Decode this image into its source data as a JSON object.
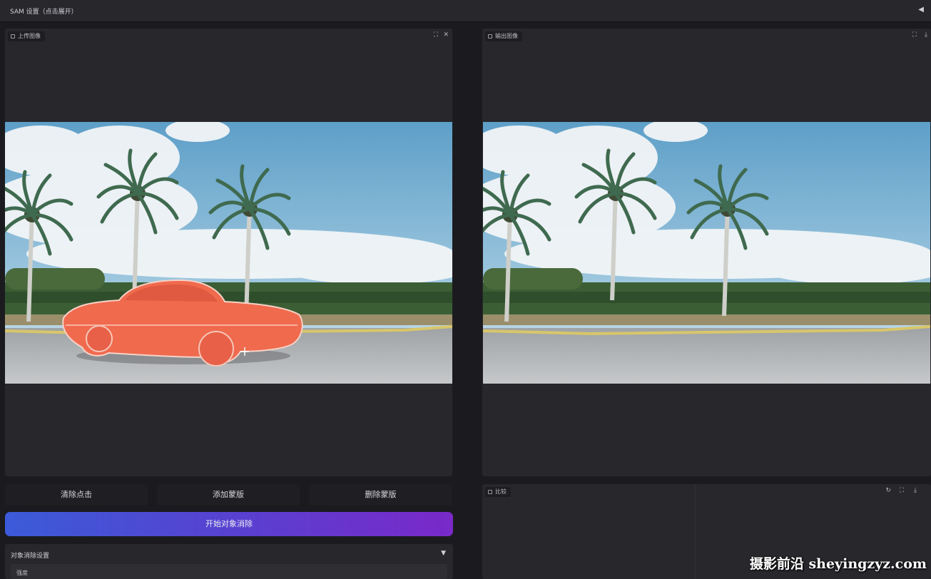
{
  "app": {
    "sam_settings_title": "SAM 设置（点击展开）",
    "collapse_glyph": "◀"
  },
  "upload_panel": {
    "label": "上传图像",
    "fullscreen_glyph": "⛶",
    "close_glyph": "✕"
  },
  "output_panel": {
    "label": "输出图像",
    "fullscreen_glyph": "⛶",
    "download_glyph": "⤓"
  },
  "compare_panel": {
    "label": "比较",
    "reset_glyph": "↻",
    "fullscreen_glyph": "⛶",
    "download_glyph": "⤓"
  },
  "actions": {
    "clear_clicks": "清除点击",
    "add_mask": "添加蒙版",
    "delete_mask": "删除蒙版",
    "start_removal": "开始对象消除"
  },
  "removal_settings": {
    "title": "对象消除设置",
    "caret": "▼",
    "field_label": "强度"
  },
  "watermark": "摄影前沿 sheyingzyz.com",
  "icons": [
    "panel-icon",
    "fullscreen-icon",
    "close-icon",
    "download-icon",
    "reset-icon",
    "crosshair-icon"
  ],
  "colors": {
    "mask_overlay": "#f06a4e",
    "primary_gradient_start": "#3b5bd9",
    "primary_gradient_end": "#7a29c8"
  }
}
